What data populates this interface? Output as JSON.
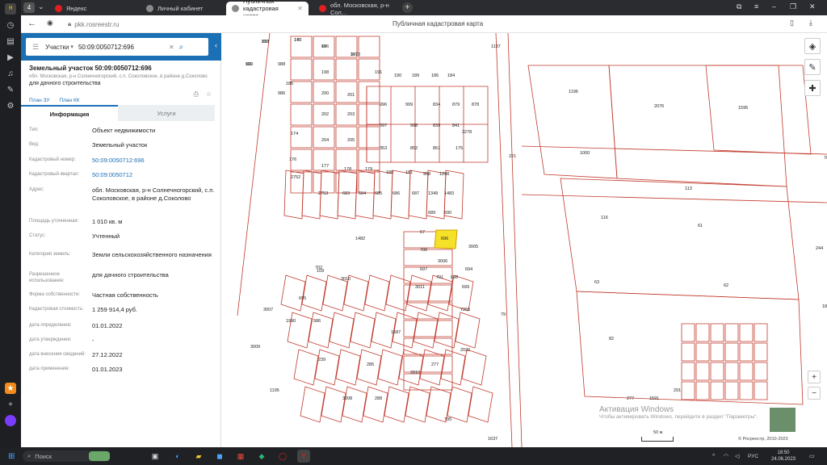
{
  "browser": {
    "tab_count": "4",
    "tabs": [
      {
        "label": "Яндекс",
        "favicon": "yandex-icon",
        "color": "#e02020"
      },
      {
        "label": "Личный кабинет",
        "favicon": "page-icon",
        "color": "#8a8a8a"
      },
      {
        "label": "Публичная кадастровая карта",
        "favicon": "page-icon",
        "color": "#8a8a8a"
      },
      {
        "label": "обл. Московская, р-н Сол...",
        "favicon": "yandex-icon",
        "color": "#e02020"
      }
    ],
    "url": "pkk.rosreestr.ru",
    "page_title": "Публичная кадастровая карта"
  },
  "search": {
    "type_label": "Участки",
    "query": "50:09:0050712:696"
  },
  "parcel": {
    "title": "Земельный участок 50:09:0050712:696",
    "address_line1": "обл. Московская, р-н Солнечногорский, с.п. Соколовское, в районе д.Соколово",
    "address_line2": "для дачного строительства",
    "link_plan_zu": "План ЗУ",
    "link_plan_kk": "План КК",
    "tab_info": "Информация",
    "tab_services": "Услуги",
    "fields": [
      {
        "k": "Тип:",
        "v": "Объект недвижимости",
        "link": false
      },
      {
        "k": "Вид:",
        "v": "Земельный участок",
        "link": false
      },
      {
        "k": "Кадастровый номер:",
        "v": "50:09:0050712:696",
        "link": true
      },
      {
        "k": "Кадастровый квартал:",
        "v": "50:09:0050712",
        "link": true
      },
      {
        "k": "Адрес:",
        "v": "обл. Московская, р-н Солнечногорский, с.п. Соколовское, в районе д.Соколово",
        "link": false
      },
      {
        "k": "Площадь уточненная:",
        "v": "1 010 кв. м",
        "link": false
      },
      {
        "k": "Статус:",
        "v": "Учтенный",
        "link": false
      },
      {
        "k": "Категория земель:",
        "v": "Земли сельскохозяйственного назначения",
        "link": false
      },
      {
        "k": "Разрешенное использование:",
        "v": "для дачного строительства",
        "link": false
      },
      {
        "k": "Форма собственности:",
        "v": "Частная собственность",
        "link": false
      },
      {
        "k": "Кадастровая стоимость:",
        "v": "1 259 914,4 руб.",
        "link": false
      },
      {
        "k": "дата определения:",
        "v": "01.01.2022",
        "link": false
      },
      {
        "k": "дата утверждения:",
        "v": "-",
        "link": false
      },
      {
        "k": "дата внесения сведений:",
        "v": "27.12.2022",
        "link": false
      },
      {
        "k": "дата применения:",
        "v": "01.01.2023",
        "link": false
      }
    ]
  },
  "map": {
    "selected": "696",
    "labels": [
      "993",
      "170",
      "989",
      "196",
      "197",
      "988",
      "185",
      "198",
      "191",
      "190",
      "189",
      "186",
      "184",
      "1137",
      "986",
      "200",
      "201",
      "996",
      "999",
      "834",
      "879",
      "878",
      "202",
      "203",
      "997",
      "998",
      "839",
      "841",
      "3278",
      "174",
      "204",
      "205",
      "953",
      "852",
      "851",
      "175",
      "176",
      "177",
      "178",
      "179",
      "180",
      "181",
      "958",
      "1298",
      "221",
      "2752",
      "2753",
      "683",
      "684",
      "685",
      "686",
      "687",
      "1349",
      "1483",
      "689",
      "690",
      "1482",
      "67",
      "3005",
      "700",
      "3006",
      "697",
      "694",
      "701",
      "698",
      "699",
      "702",
      "3010",
      "3011",
      "695",
      "7255",
      "3007",
      "1990",
      "586",
      "1587",
      "2032",
      "3009",
      "239",
      "285",
      "2810",
      "277",
      "1195",
      "3008",
      "288",
      "1591",
      "277",
      "291",
      "1637",
      "795",
      "787",
      "244",
      "2076",
      "1595",
      "1196",
      "1000",
      "1855",
      "113",
      "116",
      "61",
      "62",
      "63",
      "82",
      "79",
      "109",
      "110",
      "140",
      "111",
      "68",
      "3010"
    ],
    "scale_label": "50 м",
    "copyright": "© Росреестр, 2010-2023"
  },
  "watermark": {
    "line1": "Активация Windows",
    "line2": "Чтобы активировать Windows, перейдите в раздел \"Параметры\"."
  },
  "taskbar": {
    "search_label": "Поиск",
    "time": "18:50",
    "date": "24.06.2023",
    "lang": "РУС"
  },
  "colors": {
    "accent": "#1a6fb5",
    "parcel_line": "#c0392b",
    "selected": "#f5e02a"
  }
}
